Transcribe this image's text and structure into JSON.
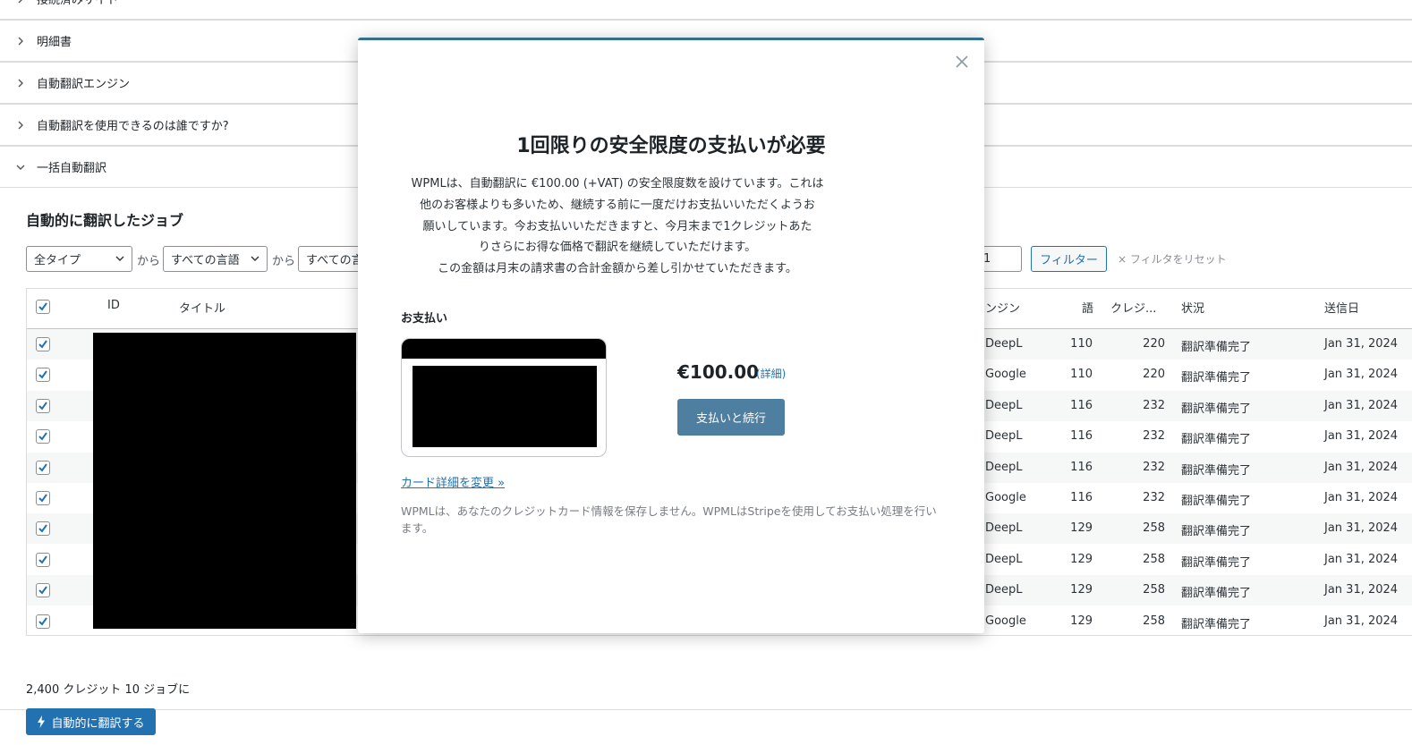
{
  "accordion": [
    {
      "label": "接続済みサイト"
    },
    {
      "label": "明細書"
    },
    {
      "label": "自動翻訳エンジン"
    },
    {
      "label": "自動翻訳を使用できるのは誰ですか?"
    },
    {
      "label": "一括自動翻訳"
    }
  ],
  "jobs": {
    "title": "自動的に翻訳したジョブ",
    "filters": {
      "type_select": "全タイプ",
      "from_1": "から",
      "source_lang_select": "すべての言語",
      "from_2": "から",
      "target_lang_select": "すべての言",
      "date_value": "1",
      "filter_button": "フィルター",
      "reset_link": "× フィルタをリセット"
    },
    "columns": {
      "id": "ID",
      "title": "タイトル",
      "engine": "ンジン",
      "words": "語",
      "credits": "クレジ...",
      "status": "状況",
      "sent_date": "送信日"
    },
    "rows": [
      {
        "engine": "DeepL",
        "words": "110",
        "credits": "220",
        "status": "翻訳準備完了",
        "date": "Jan 31, 2024"
      },
      {
        "engine": "Google",
        "words": "110",
        "credits": "220",
        "status": "翻訳準備完了",
        "date": "Jan 31, 2024"
      },
      {
        "engine": "DeepL",
        "words": "116",
        "credits": "232",
        "status": "翻訳準備完了",
        "date": "Jan 31, 2024"
      },
      {
        "engine": "DeepL",
        "words": "116",
        "credits": "232",
        "status": "翻訳準備完了",
        "date": "Jan 31, 2024"
      },
      {
        "engine": "DeepL",
        "words": "116",
        "credits": "232",
        "status": "翻訳準備完了",
        "date": "Jan 31, 2024"
      },
      {
        "engine": "Google",
        "words": "116",
        "credits": "232",
        "status": "翻訳準備完了",
        "date": "Jan 31, 2024"
      },
      {
        "engine": "DeepL",
        "words": "129",
        "credits": "258",
        "status": "翻訳準備完了",
        "date": "Jan 31, 2024"
      },
      {
        "engine": "DeepL",
        "words": "129",
        "credits": "258",
        "status": "翻訳準備完了",
        "date": "Jan 31, 2024"
      },
      {
        "engine": "DeepL",
        "words": "129",
        "credits": "258",
        "status": "翻訳準備完了",
        "date": "Jan 31, 2024"
      },
      {
        "engine": "Google",
        "words": "129",
        "credits": "258",
        "status": "翻訳準備完了",
        "date": "Jan 31, 2024"
      }
    ],
    "summary": "2,400 クレジット 10 ジョブに",
    "auto_translate_button": "自動的に翻訳する"
  },
  "modal": {
    "title": "1回限りの安全限度の支払いが必要",
    "description_lines": [
      "WPMLは、自動翻訳に €100.00 (+VAT) の安全限度数を設けています。これは",
      "他のお客様よりも多いため、継続する前に一度だけお支払いいただくようお",
      "願いしています。今お支払いいただきますと、今月末まで1クレジットあた",
      "りさらにお得な価格で翻訳を継続していただけます。",
      "この金額は月末の請求書の合計金額から差し引かせていただきます。"
    ],
    "payment_label": "お支払い",
    "amount": "€100.00",
    "details_link": "(詳細)",
    "pay_button": "支払いと続行",
    "change_card_link": "カード詳細を変更 »",
    "stripe_note": "WPMLは、あなたのクレジットカード情報を保存しません。WPMLはStripeを使用してお支払い処理を行います。"
  },
  "colors": {
    "accent": "#2271b1",
    "modal_border": "#33708f",
    "pay_button": "#4e7fa0"
  }
}
